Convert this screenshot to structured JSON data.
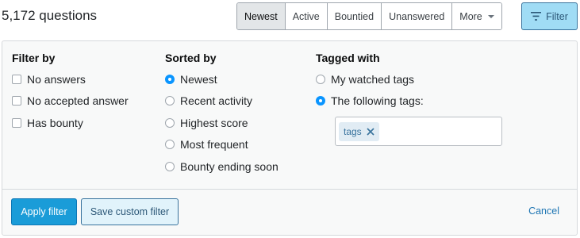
{
  "header": {
    "question_count": "5,172 questions",
    "sort_tabs": [
      {
        "label": "Newest"
      },
      {
        "label": "Active"
      },
      {
        "label": "Bountied"
      },
      {
        "label": "Unanswered"
      },
      {
        "label": "More"
      }
    ],
    "filter_label": "Filter"
  },
  "filter_panel": {
    "filter_by": {
      "heading": "Filter by",
      "options": [
        {
          "label": "No answers",
          "checked": false
        },
        {
          "label": "No accepted answer",
          "checked": false
        },
        {
          "label": "Has bounty",
          "checked": false
        }
      ]
    },
    "sorted_by": {
      "heading": "Sorted by",
      "selected": "Newest",
      "options": [
        {
          "label": "Newest"
        },
        {
          "label": "Recent activity"
        },
        {
          "label": "Highest score"
        },
        {
          "label": "Most frequent"
        },
        {
          "label": "Bounty ending soon"
        }
      ]
    },
    "tagged_with": {
      "heading": "Tagged with",
      "selected": "The following tags:",
      "options": [
        {
          "label": "My watched tags"
        },
        {
          "label": "The following tags:"
        }
      ],
      "tags": [
        {
          "label": "tags"
        }
      ]
    },
    "footer": {
      "apply_label": "Apply filter",
      "save_label": "Save custom filter",
      "cancel_label": "Cancel"
    }
  },
  "colors": {
    "accent": "#0a95ff",
    "filter_button_bg": "#a0dcf5",
    "tag_bg": "#e1ecf4",
    "tag_text": "#39739d",
    "link": "#1d75b3"
  }
}
